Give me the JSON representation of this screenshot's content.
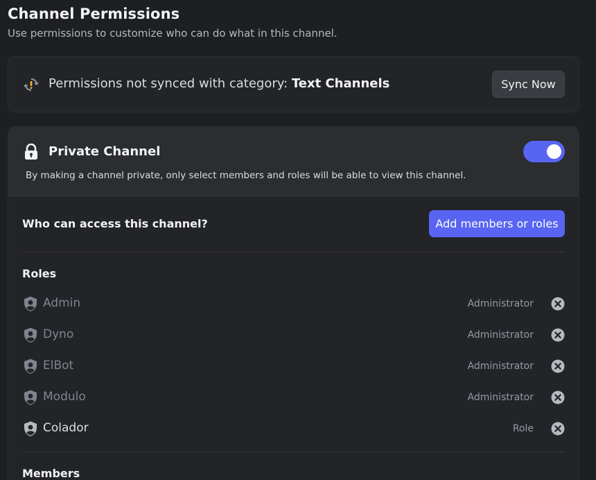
{
  "header": {
    "title": "Channel Permissions",
    "subtitle": "Use permissions to customize who can do what in this channel."
  },
  "sync": {
    "message": "Permissions not synced with category:",
    "category": "Text Channels",
    "button_label": "Sync Now"
  },
  "private": {
    "title": "Private Channel",
    "enabled": true,
    "description": "By making a channel private, only select members and roles will be able to view this channel."
  },
  "access": {
    "title": "Who can access this channel?",
    "add_button_label": "Add members or roles"
  },
  "roles": {
    "label": "Roles",
    "items": [
      {
        "name": "Admin",
        "type": "Administrator"
      },
      {
        "name": "Dyno",
        "type": "Administrator"
      },
      {
        "name": "ElBot",
        "type": "Administrator"
      },
      {
        "name": "Modulo",
        "type": "Administrator"
      },
      {
        "name": "Colador",
        "type": "Role"
      }
    ]
  },
  "members": {
    "label": "Members"
  },
  "colors": {
    "accent": "#5865f2",
    "background": "#1e1f22",
    "card": "#232428",
    "warning": "#f0b232"
  },
  "icons": {
    "sync": "sync-warning-icon",
    "lock": "lock-icon",
    "role": "role-shield-icon",
    "remove": "remove-circle-x-icon"
  }
}
